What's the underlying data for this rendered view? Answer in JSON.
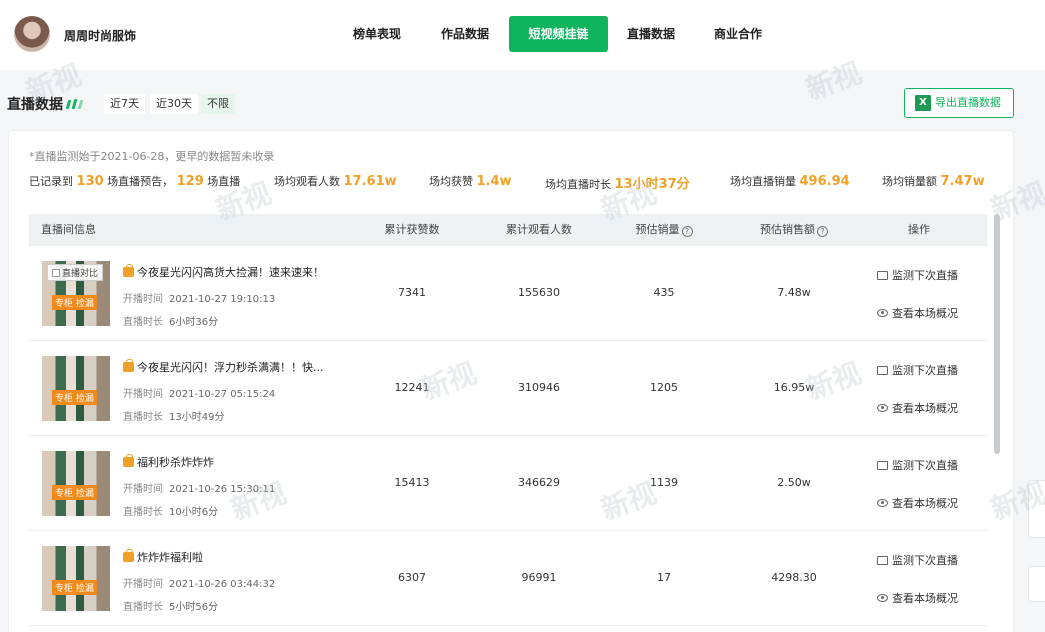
{
  "header": {
    "brand": "周周时尚服饰",
    "nav": [
      {
        "label": "榜单表现",
        "active": false
      },
      {
        "label": "作品数据",
        "active": false
      },
      {
        "label": "短视频挂链",
        "active": true
      },
      {
        "label": "直播数据",
        "active": false
      },
      {
        "label": "商业合作",
        "active": false
      }
    ]
  },
  "section": {
    "title": "直播数据",
    "ranges": [
      "近7天",
      "近30天",
      "不限"
    ],
    "active_range": "不限",
    "export_label": "导出直播数据"
  },
  "summary": {
    "note": "*直播监测始于2021-06-28，更早的数据暂未收录",
    "recorded_prefix": "已记录到",
    "preview_count": "130",
    "preview_label": "场直播预告，",
    "live_count": "129",
    "live_label": "场直播",
    "avg_viewers_label": "场均观看人数",
    "avg_viewers": "17.61w",
    "avg_likes_label": "场均获赞",
    "avg_likes": "1.4w",
    "avg_duration_label": "场均直播时长",
    "avg_duration": "13小时37分",
    "avg_sales_label": "场均直播销量",
    "avg_sales": "496.94",
    "avg_revenue_label": "场均销量额",
    "avg_revenue": "7.47w"
  },
  "table": {
    "columns": {
      "info": "直播间信息",
      "likes": "累计获赞数",
      "viewers": "累计观看人数",
      "sales": "预估销量",
      "revenue": "预估销售额",
      "actions": "操作"
    },
    "thumb_tag": "专柜 捡漏",
    "compare_label": "直播对比",
    "start_label": "开播时间",
    "duration_label": "直播时长",
    "monitor_label": "监测下次直播",
    "overview_label": "查看本场概况",
    "rows": [
      {
        "title": "今夜星光闪闪高货大捡漏！速来速来！",
        "start": "2021-10-27 19:10:13",
        "duration": "6小时36分",
        "likes": "7341",
        "viewers": "155630",
        "sales": "435",
        "revenue": "7.48w"
      },
      {
        "title": "今夜星光闪闪！浮力秒杀满满！！快...",
        "start": "2021-10-27 05:15:24",
        "duration": "13小时49分",
        "likes": "12241",
        "viewers": "310946",
        "sales": "1205",
        "revenue": "16.95w"
      },
      {
        "title": "福利秒杀炸炸炸",
        "start": "2021-10-26 15:30:11",
        "duration": "10小时6分",
        "likes": "15413",
        "viewers": "346629",
        "sales": "1139",
        "revenue": "2.50w"
      },
      {
        "title": "炸炸炸福利啦",
        "start": "2021-10-26 03:44:32",
        "duration": "5小时56分",
        "likes": "6307",
        "viewers": "96991",
        "sales": "17",
        "revenue": "4298.30"
      }
    ]
  },
  "watermark": "新视",
  "colors": {
    "brand_green": "#10b45e",
    "highlight_orange": "#f0a027"
  }
}
